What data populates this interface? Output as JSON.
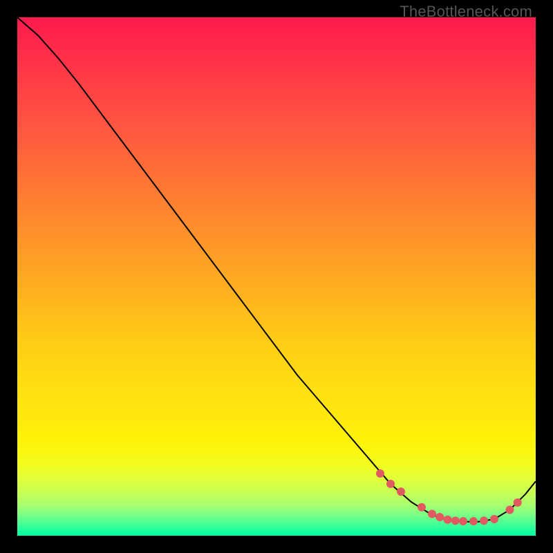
{
  "watermark": "TheBottleneck.com",
  "colors": {
    "frame_bg": "#000000",
    "curve": "#000000",
    "marker": "#e05a60",
    "gradient_top": "#ff1a4d",
    "gradient_bottom": "#00ffa0"
  },
  "chart_data": {
    "type": "line",
    "title": "",
    "xlabel": "",
    "ylabel": "",
    "xlim": [
      0,
      100
    ],
    "ylim": [
      0,
      100
    ],
    "note": "x and y are normalized 0-100 within the colored plot area; y=0 is the bottom (green) and y=100 is the top (red).",
    "series": [
      {
        "name": "curve",
        "x": [
          0,
          4,
          8,
          12,
          18,
          24,
          30,
          36,
          42,
          48,
          54,
          60,
          66,
          72,
          76,
          80,
          83,
          86,
          89,
          92,
          95,
          98,
          100
        ],
        "y": [
          100,
          96.5,
          92,
          87,
          79,
          71,
          63,
          55,
          47,
          39,
          31,
          24,
          17,
          10,
          6.5,
          4,
          3,
          2.7,
          2.7,
          3.2,
          5,
          8,
          10.5
        ]
      }
    ],
    "markers": {
      "name": "highlighted-points",
      "x": [
        70,
        72,
        74,
        78,
        80,
        81.5,
        83,
        84.5,
        86,
        88,
        90,
        92,
        95,
        96.5
      ],
      "y": [
        12,
        10,
        8.5,
        5.5,
        4.2,
        3.6,
        3.1,
        2.9,
        2.8,
        2.8,
        2.9,
        3.2,
        5,
        6.4
      ],
      "radius": 6
    }
  }
}
